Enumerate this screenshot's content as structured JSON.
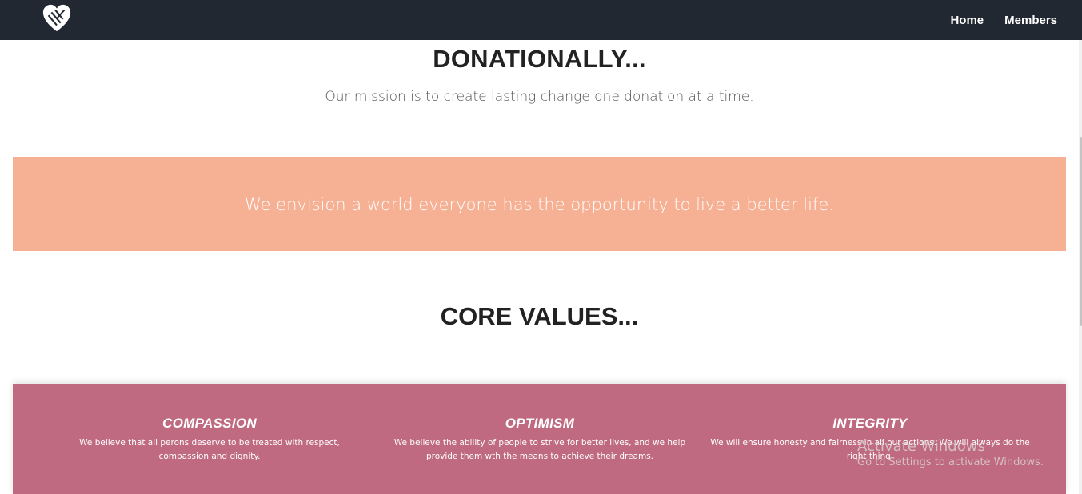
{
  "nav": {
    "logo_icon": "heart-hands-icon",
    "links": [
      "Home",
      "Members"
    ]
  },
  "hero": {
    "title": "DONATIONALLY...",
    "mission": "Our mission is to create lasting change one donation at a time."
  },
  "vision": {
    "text": "We envision a world everyone has the opportunity to live a better life.",
    "background": "#f6b094"
  },
  "core_values": {
    "title": "CORE VALUES...",
    "background": "#bf6a80",
    "items": [
      {
        "title": "COMPASSION",
        "text": "We believe that all perons deserve to be treated with respect, compassion and dignity."
      },
      {
        "title": "OPTIMISM",
        "text": "We believe the ability of people to strive for better lives, and we help provide them wth the means to achieve their dreams."
      },
      {
        "title": "INTEGRITY",
        "text": "We will ensure honesty and fairness in all our actions. We will always do the right thing."
      }
    ]
  },
  "watermark": {
    "line1": "Activate Windows",
    "line2": "Go to Settings to activate Windows."
  },
  "colors": {
    "navbar": "#222831",
    "vision": "#f6b094",
    "values": "#bf6a80"
  }
}
